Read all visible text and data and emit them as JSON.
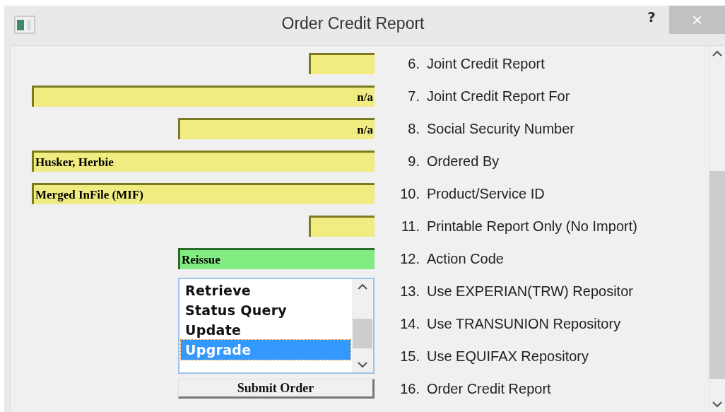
{
  "window": {
    "title": "Order Credit Report",
    "help": "?",
    "close": "×"
  },
  "rows": [
    {
      "number": "6.",
      "label": "Joint Credit Report",
      "control": {
        "kind": "flag",
        "highlighted": false
      }
    },
    {
      "number": "7.",
      "label": "Joint Credit Report For",
      "control": {
        "kind": "joint",
        "value": "n/a",
        "highlighted": false
      }
    },
    {
      "number": "8.",
      "label": "Social Security Number",
      "control": {
        "kind": "ssn",
        "value": "n/a",
        "highlighted": false
      }
    },
    {
      "number": "9.",
      "label": "Ordered By",
      "control": {
        "kind": "text",
        "value": "Husker, Herbie",
        "highlighted": false
      }
    },
    {
      "number": "10.",
      "label": "Product/Service ID",
      "control": {
        "kind": "text",
        "value": "Merged InFile (MIF)",
        "highlighted": false
      }
    },
    {
      "number": "11.",
      "label": "Printable Report Only (No Import)",
      "control": {
        "kind": "flag",
        "highlighted": false
      }
    },
    {
      "number": "12.",
      "label": "Action Code",
      "control": {
        "kind": "code",
        "value": "Reissue",
        "highlighted": true
      }
    },
    {
      "number": "13.",
      "label": "Use EXPERIAN(TRW) Repositor"
    },
    {
      "number": "14.",
      "label": "Use TRANSUNION Repository"
    },
    {
      "number": "15.",
      "label": "Use EQUIFAX Repository"
    },
    {
      "number": "16.",
      "label": "Order Credit Report"
    }
  ],
  "action_list": {
    "items": [
      {
        "label": "Retrieve",
        "selected": false
      },
      {
        "label": "Status Query",
        "selected": false
      },
      {
        "label": "Update",
        "selected": false
      },
      {
        "label": "Upgrade",
        "selected": true
      }
    ]
  },
  "submit_button": "Submit Order"
}
